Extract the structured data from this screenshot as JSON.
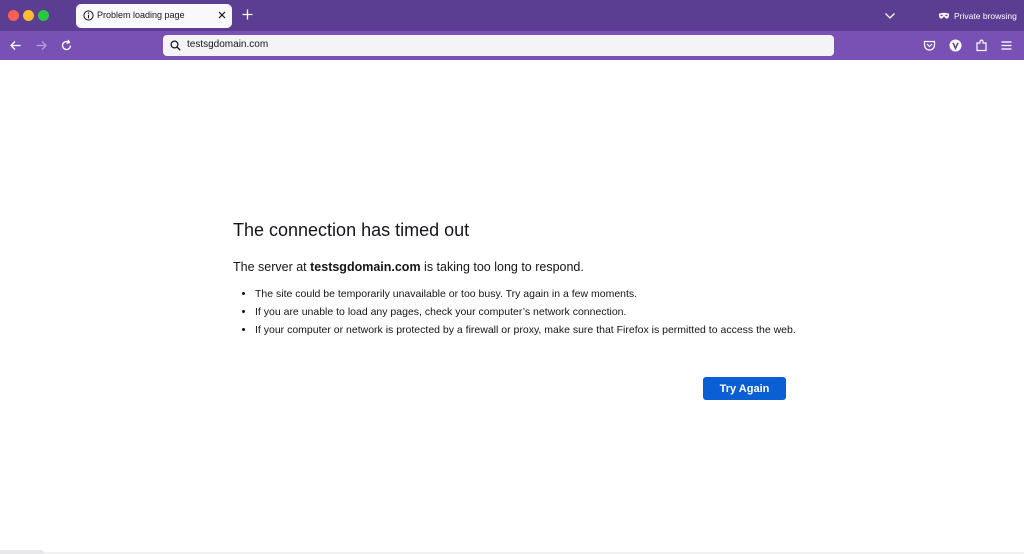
{
  "browser": {
    "tab": {
      "title": "Problem loading page"
    },
    "private_label": "Private browsing",
    "url": "testsgdomain.com",
    "colors": {
      "titlebar": "#5b3d92",
      "toolbar": "#7950b4",
      "accent_button": "#0b5fd4"
    },
    "icons": {
      "tab_status": "info-icon",
      "tab_close": "close-icon",
      "new_tab": "plus-icon",
      "tab_list": "chevron-down-icon",
      "private": "mask-icon",
      "back": "back-arrow-icon",
      "forward": "forward-arrow-icon",
      "reload": "reload-icon",
      "url_search": "search-icon",
      "pocket": "pocket-icon",
      "account": "account-icon",
      "extensions": "extensions-icon",
      "menu": "hamburger-menu-icon"
    }
  },
  "error_page": {
    "title": "The connection has timed out",
    "description": {
      "prefix": "The server at ",
      "domain": "testsgdomain.com",
      "suffix": " is taking too long to respond."
    },
    "items": [
      "The site could be temporarily unavailable or too busy. Try again in a few moments.",
      "If you are unable to load any pages, check your computer’s network connection.",
      "If your computer or network is protected by a firewall or proxy, make sure that Firefox is permitted to access the web."
    ],
    "button_label": "Try Again"
  }
}
